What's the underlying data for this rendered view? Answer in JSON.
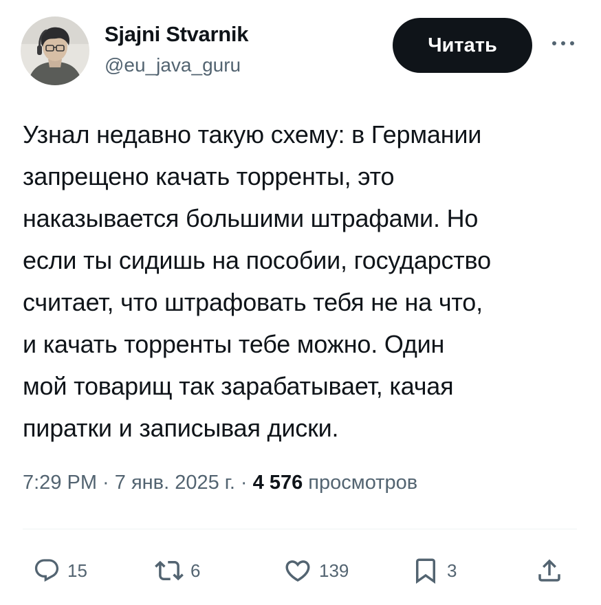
{
  "author": {
    "name": "Sjajni Stvarnik",
    "handle": "@eu_java_guru",
    "avatar_icon": "user-avatar"
  },
  "follow_button": {
    "label": "Читать"
  },
  "more_icon": "more-dots-icon",
  "tweet": {
    "text": "Узнал недавно такую схему: в Германии\nзапрещено качать торренты, это\nнаказывается большими штрафами. Но\nесли ты сидишь на пособии, государство\nсчитает, что штрафовать тебя не на что,\nи качать торренты тебе можно. Один\nмой товарищ так зарабатывает, качая\nпиратки и записывая диски."
  },
  "meta": {
    "time": "7:29 PM",
    "sep1": " · ",
    "date": "7 янв. 2025 г.",
    "sep2": " · ",
    "views_count": "4 576",
    "views_label": " просмотров"
  },
  "actions": {
    "replies": "15",
    "reposts": "6",
    "likes": "139",
    "bookmarks": "3"
  },
  "colors": {
    "text": "#0f1419",
    "secondary": "#536471",
    "button_bg": "#0f1419",
    "divider": "#eff3f4"
  }
}
